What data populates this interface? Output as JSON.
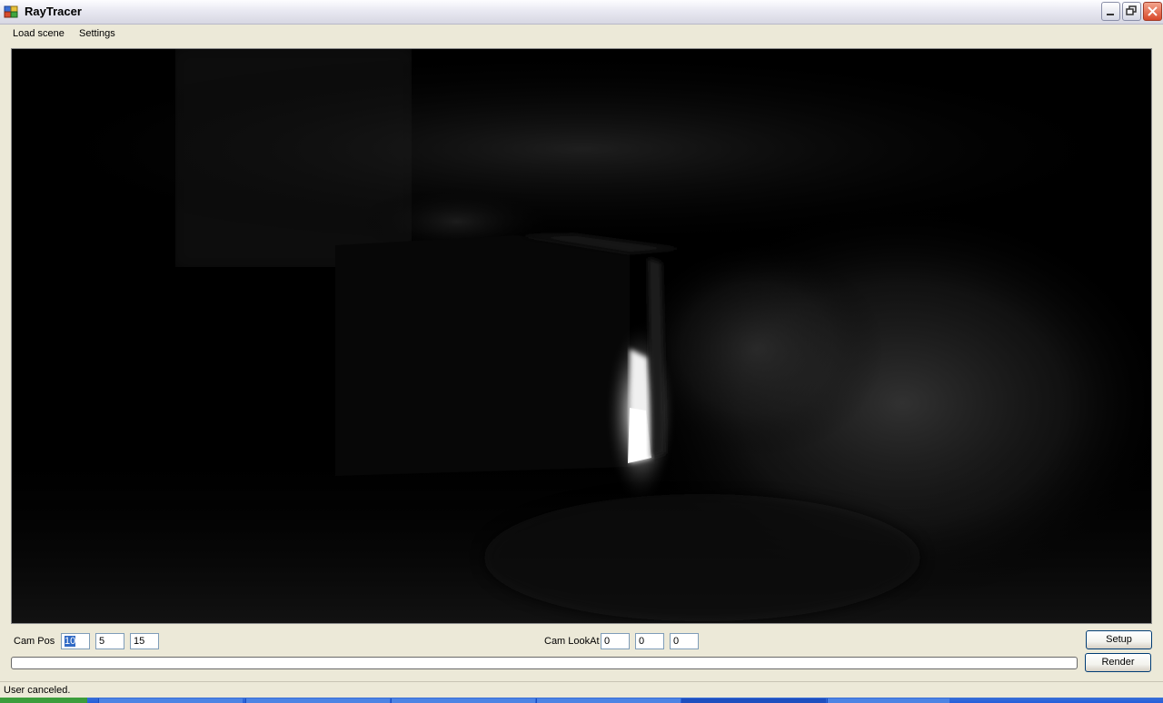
{
  "window": {
    "title": "RayTracer",
    "icon": "app-icon"
  },
  "menu": {
    "items": [
      "Load scene",
      "Settings"
    ]
  },
  "viewport": {
    "content": "rendered-scene"
  },
  "controls": {
    "cam_pos_label": "Cam Pos",
    "cam_pos": [
      "10",
      "5",
      "15"
    ],
    "cam_lookat_label": "Cam LookAt",
    "cam_lookat": [
      "0",
      "0",
      "0"
    ],
    "setup_label": "Setup",
    "render_label": "Render",
    "progress": 0
  },
  "status": {
    "text": "User canceled."
  },
  "colors": {
    "accent": "#316ac5",
    "progress": "#2fb52f"
  }
}
